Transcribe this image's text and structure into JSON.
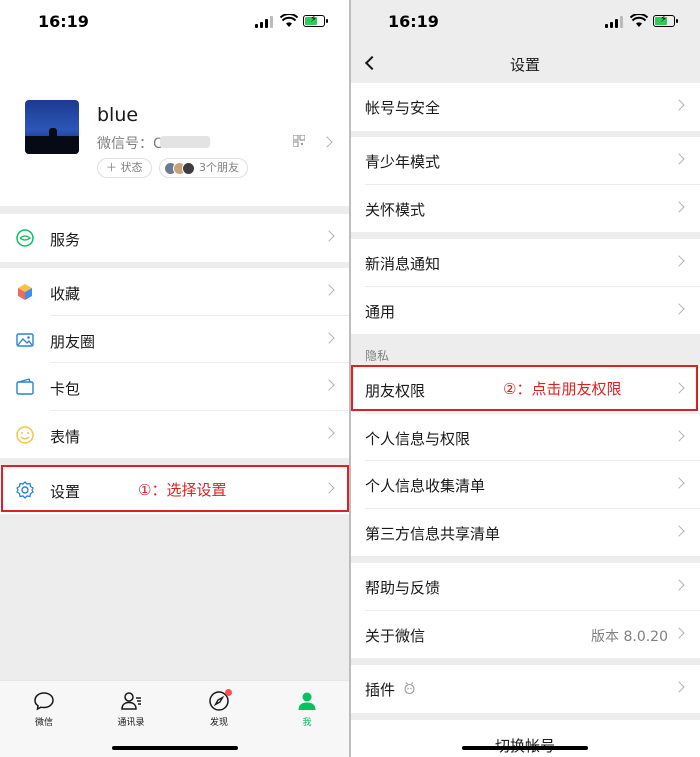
{
  "left": {
    "status": {
      "time": "16:19"
    },
    "profile": {
      "name": "blue",
      "wechat_id_label": "微信号：",
      "wechat_id_value_partial": "C",
      "status_button": "＋ 状态",
      "friends_button": "3个朋友"
    },
    "menu": {
      "services": "服务",
      "favorites": "收藏",
      "moments": "朋友圈",
      "cards": "卡包",
      "stickers": "表情",
      "settings": "设置"
    },
    "annotation_1": "①：选择设置",
    "tabs": [
      {
        "label": "微信",
        "icon": "chat-icon"
      },
      {
        "label": "通讯录",
        "icon": "contacts-icon"
      },
      {
        "label": "发现",
        "icon": "discover-icon"
      },
      {
        "label": "我",
        "icon": "me-icon"
      }
    ]
  },
  "right": {
    "status": {
      "time": "16:19"
    },
    "title": "设置",
    "items": {
      "account_security": "帐号与安全",
      "teen_mode": "青少年模式",
      "care_mode": "关怀模式",
      "new_msg_notify": "新消息通知",
      "general": "通用",
      "privacy_header": "隐私",
      "friend_permissions": "朋友权限",
      "personal_info_permissions": "个人信息与权限",
      "personal_info_list": "个人信息收集清单",
      "third_party_list": "第三方信息共享清单",
      "help_feedback": "帮助与反馈",
      "about_wechat": "关于微信",
      "version": "版本 8.0.20",
      "plugins": "插件",
      "switch_account_partial": "切换帐号"
    },
    "annotation_2": "②：点击朋友权限"
  },
  "colors": {
    "accent_green": "#07c160",
    "annotation_red": "#e02020",
    "background_gray": "#ededed"
  }
}
